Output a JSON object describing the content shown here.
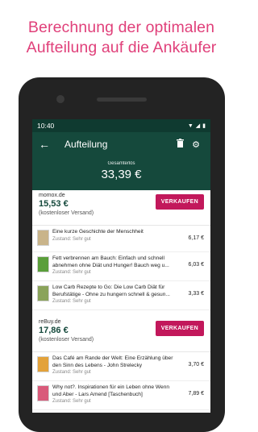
{
  "promo": {
    "line1": "Berechnung der optimalen",
    "line2": "Aufteilung auf die Ankäufer"
  },
  "status": {
    "time": "10:40"
  },
  "toolbar": {
    "title": "Aufteilung"
  },
  "total": {
    "label": "Gesamterlös",
    "value": "33,39 €"
  },
  "buyers": [
    {
      "name": "momox.de",
      "sum": "15,53 €",
      "note": "(kostenloser Versand)",
      "button": "VERKAUFEN",
      "items": [
        {
          "title": "Eine kurze Geschichte der Menschheit",
          "condition": "Zustand: Sehr gut",
          "price": "6,17 €",
          "color": "#c9b48a"
        },
        {
          "title": "Fett verbrennen am Bauch: Einfach und schnell abnehmen ohne Diät und Hunger! Bauch weg u...",
          "condition": "Zustand: Sehr gut",
          "price": "6,03 €",
          "color": "#5a9e3a"
        },
        {
          "title": "Low Carb Rezepte to Go: Die Low Carb Diät für Berufstätige - Ohne zu hungern schnell & gesun...",
          "condition": "Zustand: Sehr gut",
          "price": "3,33 €",
          "color": "#8aa35a"
        }
      ]
    },
    {
      "name": "reBuy.de",
      "sum": "17,86 €",
      "note": "(kostenloser Versand)",
      "button": "VERKAUFEN",
      "items": [
        {
          "title": "Das Café am Rande der Welt: Eine Erzählung über den Sinn des Lebens - John Strelecky",
          "condition": "Zustand: Sehr gut",
          "price": "3,70 €",
          "color": "#e3a23a"
        },
        {
          "title": "Why not?. Inspirationen für ein Leben ohne Wenn und Aber - Lars Amend [Taschenbuch]",
          "condition": "Zustand: Sehr gut",
          "price": "7,89 €",
          "color": "#d95a7a"
        }
      ]
    }
  ]
}
